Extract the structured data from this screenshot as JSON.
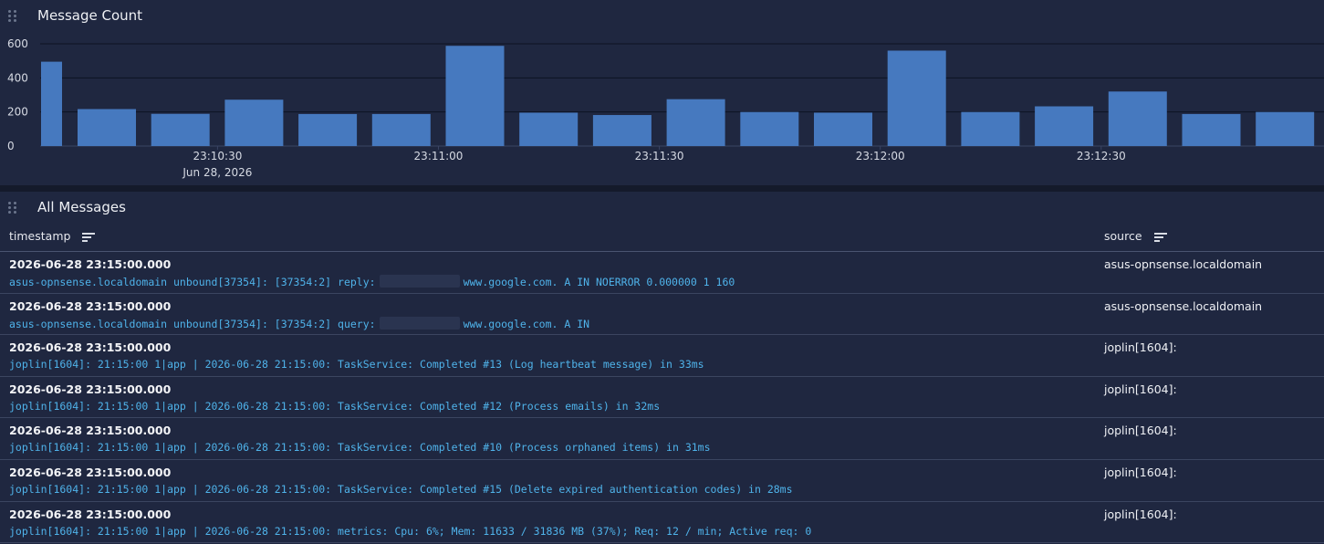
{
  "chart_panel": {
    "title": "Message Count"
  },
  "chart_data": {
    "type": "bar",
    "title": "Message Count",
    "ylim": [
      0,
      600
    ],
    "yticks": [
      0,
      200,
      400,
      600
    ],
    "bar_interval_seconds": 10,
    "x": [
      "23:10:10",
      "23:10:20",
      "23:10:30",
      "23:10:40",
      "23:10:50",
      "23:11:00",
      "23:11:10",
      "23:11:20",
      "23:11:30",
      "23:11:40",
      "23:11:50",
      "23:12:00",
      "23:12:10",
      "23:12:20",
      "23:12:30",
      "23:12:40",
      "23:12:50"
    ],
    "first_bar_partial": {
      "x": "23:10:00",
      "value": 495
    },
    "values": [
      217,
      189,
      272,
      188,
      188,
      588,
      196,
      182,
      275,
      200,
      196,
      560,
      200,
      233,
      320,
      188,
      200
    ],
    "xtick_labels": [
      "23:10:30",
      "23:11:00",
      "23:11:30",
      "23:12:00",
      "23:12:30"
    ],
    "x_date_label": "Jun 28, 2026",
    "color": "#4679bf",
    "grid": true
  },
  "messages_panel": {
    "title": "All Messages",
    "columns": {
      "timestamp": "timestamp",
      "source": "source"
    },
    "rows": [
      {
        "timestamp": "2026-06-28 23:15:00.000",
        "message_pre": "asus-opnsense.localdomain unbound[37354]: [37354:2] reply:",
        "message_post": "www.google.com. A IN NOERROR 0.000000 1 160",
        "source": "asus-opnsense.localdomain"
      },
      {
        "timestamp": "2026-06-28 23:15:00.000",
        "message_pre": "asus-opnsense.localdomain unbound[37354]: [37354:2] query:",
        "message_post": "www.google.com. A IN",
        "source": "asus-opnsense.localdomain"
      },
      {
        "timestamp": "2026-06-28 23:15:00.000",
        "message": "joplin[1604]: 21:15:00 1|app | 2026-06-28 21:15:00: TaskService: Completed #13 (Log heartbeat message) in 33ms",
        "source": "joplin[1604]:"
      },
      {
        "timestamp": "2026-06-28 23:15:00.000",
        "message": "joplin[1604]: 21:15:00 1|app | 2026-06-28 21:15:00: TaskService: Completed #12 (Process emails) in 32ms",
        "source": "joplin[1604]:"
      },
      {
        "timestamp": "2026-06-28 23:15:00.000",
        "message": "joplin[1604]: 21:15:00 1|app | 2026-06-28 21:15:00: TaskService: Completed #10 (Process orphaned items) in 31ms",
        "source": "joplin[1604]:"
      },
      {
        "timestamp": "2026-06-28 23:15:00.000",
        "message": "joplin[1604]: 21:15:00 1|app | 2026-06-28 21:15:00: TaskService: Completed #15 (Delete expired authentication codes) in 28ms",
        "source": "joplin[1604]:"
      },
      {
        "timestamp": "2026-06-28 23:15:00.000",
        "message": "joplin[1604]: 21:15:00 1|app | 2026-06-28 21:15:00: metrics: Cpu: 6%; Mem: 11633 / 31836 MB (37%); Req: 12 / min; Active req: 0",
        "source": "joplin[1604]:"
      }
    ]
  },
  "icons": {
    "drag": "drag-handle-icon",
    "sort": "sort-icon"
  }
}
